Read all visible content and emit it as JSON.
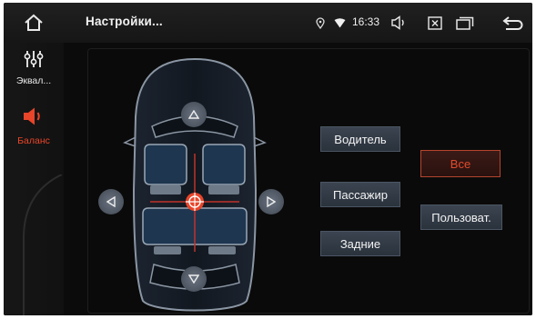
{
  "header": {
    "title": "Настройки...",
    "time": "16:33"
  },
  "sidebar": {
    "items": [
      {
        "label": "Эквал...",
        "icon": "equalizer-icon",
        "active": false
      },
      {
        "label": "Баланс",
        "icon": "speaker-icon",
        "active": true
      }
    ]
  },
  "balance": {
    "presets": {
      "driver": "Водитель",
      "passenger": "Пассажир",
      "rear": "Задние",
      "all": "Все",
      "custom": "Пользоват."
    },
    "selected_preset": "Все"
  },
  "colors": {
    "accent": "#e8452a",
    "button_bg": "#323a45",
    "seat": "#5b7a99"
  }
}
